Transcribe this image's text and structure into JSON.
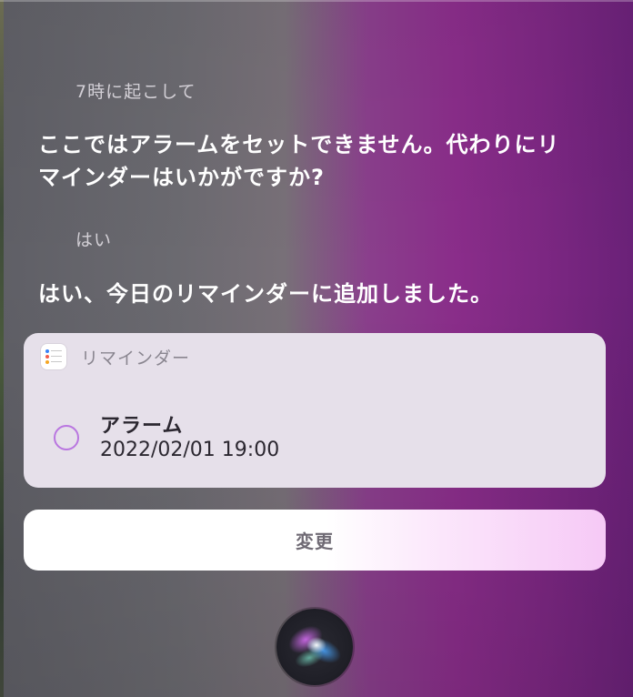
{
  "conversation": {
    "user_message_1": "7時に起こして",
    "siri_response_1": "ここではアラームをセットできません。代わりにリマインダーはいかがですか?",
    "user_message_2": "はい",
    "siri_response_2": "はい、今日のリマインダーに追加しました。"
  },
  "reminder_card": {
    "app_name": "リマインダー",
    "app_icon": "reminders-app-icon",
    "item_title": "アラーム",
    "item_datetime": "2022/02/01 19:00",
    "checkbox_icon": "empty-circle-icon",
    "checkbox_color": "#b976e0"
  },
  "actions": {
    "change_label": "変更"
  },
  "siri": {
    "icon": "siri-orb-icon"
  },
  "colors": {
    "background_left": "#6b6a70",
    "background_right": "#8a2d8a",
    "card_background": "#e6e0ea"
  }
}
